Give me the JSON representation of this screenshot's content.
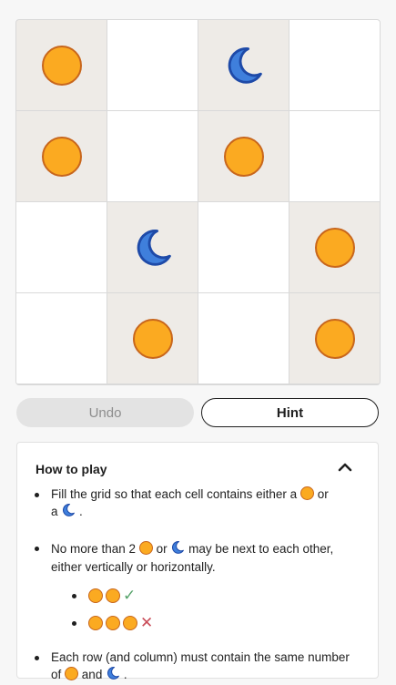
{
  "board": {
    "rows": [
      [
        {
          "symbol": "sun",
          "locked": true
        },
        {
          "symbol": "",
          "locked": false
        },
        {
          "symbol": "moon",
          "locked": true
        },
        {
          "symbol": "",
          "locked": false
        }
      ],
      [
        {
          "symbol": "sun",
          "locked": true
        },
        {
          "symbol": "",
          "locked": false
        },
        {
          "symbol": "sun",
          "locked": true
        },
        {
          "symbol": "",
          "locked": false
        }
      ],
      [
        {
          "symbol": "",
          "locked": false
        },
        {
          "symbol": "moon",
          "locked": true
        },
        {
          "symbol": "",
          "locked": false
        },
        {
          "symbol": "sun",
          "locked": true
        }
      ],
      [
        {
          "symbol": "",
          "locked": false
        },
        {
          "symbol": "sun",
          "locked": true
        },
        {
          "symbol": "",
          "locked": false
        },
        {
          "symbol": "sun",
          "locked": true
        }
      ]
    ]
  },
  "buttons": {
    "undo": "Undo",
    "hint": "Hint"
  },
  "how_to_play": {
    "title": "How to play",
    "rule1": {
      "a": "Fill the grid so that each cell contains either a",
      "b": "or",
      "c": "a",
      "d": "."
    },
    "rule2": {
      "a": "No more than 2",
      "b": "or",
      "c": "may be next to each other, either vertically or horizontally."
    },
    "examples": {
      "ok": "✓",
      "bad": "✕"
    },
    "rule3": {
      "a": "Each row (and column) must contain the same number of",
      "b": "and",
      "c": "."
    }
  },
  "colors": {
    "sun_fill": "#fbaa21",
    "sun_stroke": "#c8661c",
    "moon_fill": "#3f7fdc",
    "moon_stroke": "#1e4aa8",
    "locked_cell": "#eeebe7"
  }
}
